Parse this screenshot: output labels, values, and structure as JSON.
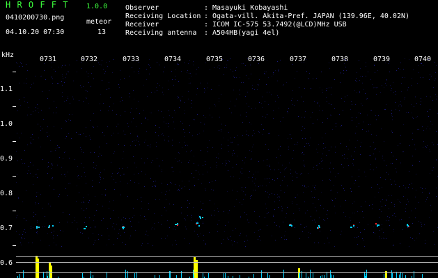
{
  "header": {
    "app_title": "H R O F F T",
    "version": "1.0.0",
    "filename": "0410200730.png",
    "meteor_label": "meteor",
    "meteor_count": "13",
    "datetime": "04.10.20 07:30",
    "info_rows": [
      {
        "label": "Observer",
        "value": ": Masayuki Kobayashi"
      },
      {
        "label": "Receiving Location",
        "value": ": Ogata-vill. Akita-Pref. JAPAN (139.96E, 40.02N)"
      },
      {
        "label": "Receiver",
        "value": ": ICOM IC-575 53.7492(@LCD)MHz USB"
      },
      {
        "label": "Receiving antenna",
        "value": ": A504HB(yagi 4el)"
      }
    ]
  },
  "axis": {
    "y_unit": "kHz",
    "y_ticks": [
      "1.1",
      "1.0",
      "0.9",
      "0.8",
      "0.7",
      "0.6"
    ],
    "x_ticks": [
      "0731",
      "0732",
      "0733",
      "0734",
      "0735",
      "0736",
      "0737",
      "0738",
      "0739",
      "0740"
    ]
  },
  "colors": {
    "background": "#000000",
    "title_green": "#3cff3c",
    "noise_blue": "#1a1a7a",
    "meteor_red": "#ff2020",
    "level_yellow": "#ffff00",
    "level_cyan": "#00d0ff"
  }
}
